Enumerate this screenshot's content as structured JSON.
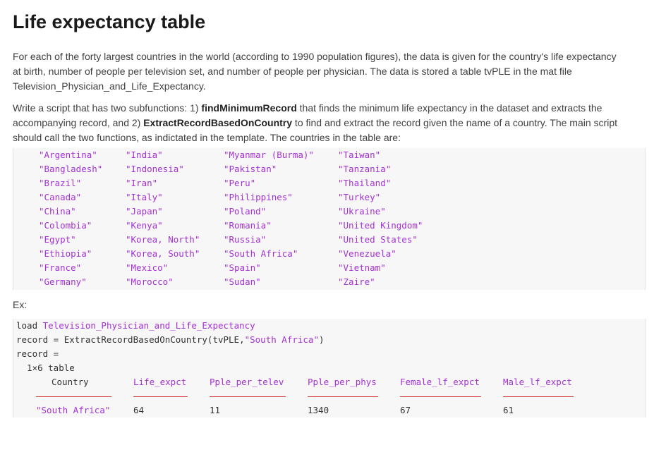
{
  "title": "Life expectancy table",
  "intro": "For each of the forty largest countries in the world (according to 1990 population figures), the data is given for the country's life expectancy at birth, number of people per television set, and number of people per physician. The data is stored a table tvPLE in the mat file Television_Physician_and_Life_Expectancy.",
  "task": {
    "part1": "Write a script that has two subfunctions: 1) ",
    "fn1": "findMinimumRecord",
    "part2": " that finds the minimum life expectancy in the dataset and extracts the accompanying record, and 2) ",
    "fn2": "ExtractRecordBasedOnCountry",
    "part3": " to find and extract the record given the name of a country.  The main script should call the two functions, as indictated in the template. The countries in the table are:"
  },
  "countries": {
    "col1": [
      "\"Argentina\"",
      "\"Bangladesh\"",
      "\"Brazil\"",
      "\"Canada\"",
      "\"China\"",
      "\"Colombia\"",
      "\"Egypt\"",
      "\"Ethiopia\"",
      "\"France\"",
      "\"Germany\""
    ],
    "col2": [
      "\"India\"",
      "\"Indonesia\"",
      "\"Iran\"",
      "\"Italy\"",
      "\"Japan\"",
      "\"Kenya\"",
      "\"Korea, North\"",
      "\"Korea, South\"",
      "\"Mexico\"",
      "\"Morocco\""
    ],
    "col3": [
      "\"Myanmar (Burma)\"",
      "\"Pakistan\"",
      "\"Peru\"",
      "\"Philippines\"",
      "\"Poland\"",
      "\"Romania\"",
      "\"Russia\"",
      "\"South Africa\"",
      "\"Spain\"",
      "\"Sudan\""
    ],
    "col4": [
      "\"Taiwan\"",
      "\"Tanzania\"",
      "\"Thailand\"",
      "\"Turkey\"",
      "\"Ukraine\"",
      "\"United Kingdom\"",
      "\"United States\"",
      "\"Venezuela\"",
      "\"Vietnam\"",
      "\"Zaire\""
    ]
  },
  "ex_label": "Ex:",
  "example": {
    "load_kw": "load ",
    "load_file": "Television_Physician_and_Life_Expectancy",
    "call_prefix": "record = ExtractRecordBasedOnCountry(tvPLE,",
    "call_arg": "\"South Africa\"",
    "call_suffix": ")",
    "record_eq": "record =",
    "table_size": "  1×6 table",
    "headers": [
      "Country",
      "Life_expct",
      "Pple_per_telev",
      "Pple_per_phys",
      "Female_lf_expct",
      "Male_lf_expct"
    ],
    "row": [
      "\"South Africa\"",
      "64",
      "11",
      "1340",
      "67",
      "61"
    ]
  }
}
